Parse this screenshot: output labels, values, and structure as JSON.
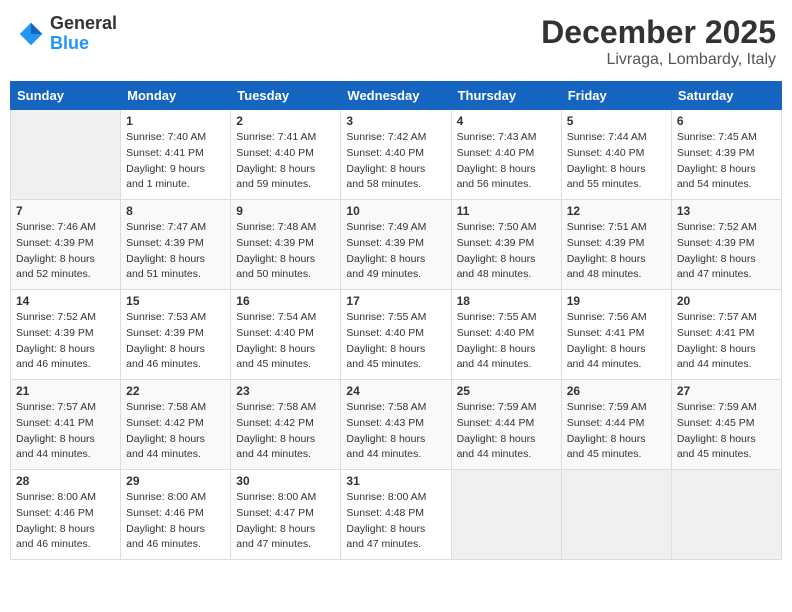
{
  "logo": {
    "general": "General",
    "blue": "Blue"
  },
  "header": {
    "month": "December 2025",
    "location": "Livraga, Lombardy, Italy"
  },
  "days_of_week": [
    "Sunday",
    "Monday",
    "Tuesday",
    "Wednesday",
    "Thursday",
    "Friday",
    "Saturday"
  ],
  "weeks": [
    [
      {
        "day": "",
        "sunrise": "",
        "sunset": "",
        "daylight": ""
      },
      {
        "day": "1",
        "sunrise": "Sunrise: 7:40 AM",
        "sunset": "Sunset: 4:41 PM",
        "daylight": "Daylight: 9 hours and 1 minute."
      },
      {
        "day": "2",
        "sunrise": "Sunrise: 7:41 AM",
        "sunset": "Sunset: 4:40 PM",
        "daylight": "Daylight: 8 hours and 59 minutes."
      },
      {
        "day": "3",
        "sunrise": "Sunrise: 7:42 AM",
        "sunset": "Sunset: 4:40 PM",
        "daylight": "Daylight: 8 hours and 58 minutes."
      },
      {
        "day": "4",
        "sunrise": "Sunrise: 7:43 AM",
        "sunset": "Sunset: 4:40 PM",
        "daylight": "Daylight: 8 hours and 56 minutes."
      },
      {
        "day": "5",
        "sunrise": "Sunrise: 7:44 AM",
        "sunset": "Sunset: 4:40 PM",
        "daylight": "Daylight: 8 hours and 55 minutes."
      },
      {
        "day": "6",
        "sunrise": "Sunrise: 7:45 AM",
        "sunset": "Sunset: 4:39 PM",
        "daylight": "Daylight: 8 hours and 54 minutes."
      }
    ],
    [
      {
        "day": "7",
        "sunrise": "Sunrise: 7:46 AM",
        "sunset": "Sunset: 4:39 PM",
        "daylight": "Daylight: 8 hours and 52 minutes."
      },
      {
        "day": "8",
        "sunrise": "Sunrise: 7:47 AM",
        "sunset": "Sunset: 4:39 PM",
        "daylight": "Daylight: 8 hours and 51 minutes."
      },
      {
        "day": "9",
        "sunrise": "Sunrise: 7:48 AM",
        "sunset": "Sunset: 4:39 PM",
        "daylight": "Daylight: 8 hours and 50 minutes."
      },
      {
        "day": "10",
        "sunrise": "Sunrise: 7:49 AM",
        "sunset": "Sunset: 4:39 PM",
        "daylight": "Daylight: 8 hours and 49 minutes."
      },
      {
        "day": "11",
        "sunrise": "Sunrise: 7:50 AM",
        "sunset": "Sunset: 4:39 PM",
        "daylight": "Daylight: 8 hours and 48 minutes."
      },
      {
        "day": "12",
        "sunrise": "Sunrise: 7:51 AM",
        "sunset": "Sunset: 4:39 PM",
        "daylight": "Daylight: 8 hours and 48 minutes."
      },
      {
        "day": "13",
        "sunrise": "Sunrise: 7:52 AM",
        "sunset": "Sunset: 4:39 PM",
        "daylight": "Daylight: 8 hours and 47 minutes."
      }
    ],
    [
      {
        "day": "14",
        "sunrise": "Sunrise: 7:52 AM",
        "sunset": "Sunset: 4:39 PM",
        "daylight": "Daylight: 8 hours and 46 minutes."
      },
      {
        "day": "15",
        "sunrise": "Sunrise: 7:53 AM",
        "sunset": "Sunset: 4:39 PM",
        "daylight": "Daylight: 8 hours and 46 minutes."
      },
      {
        "day": "16",
        "sunrise": "Sunrise: 7:54 AM",
        "sunset": "Sunset: 4:40 PM",
        "daylight": "Daylight: 8 hours and 45 minutes."
      },
      {
        "day": "17",
        "sunrise": "Sunrise: 7:55 AM",
        "sunset": "Sunset: 4:40 PM",
        "daylight": "Daylight: 8 hours and 45 minutes."
      },
      {
        "day": "18",
        "sunrise": "Sunrise: 7:55 AM",
        "sunset": "Sunset: 4:40 PM",
        "daylight": "Daylight: 8 hours and 44 minutes."
      },
      {
        "day": "19",
        "sunrise": "Sunrise: 7:56 AM",
        "sunset": "Sunset: 4:41 PM",
        "daylight": "Daylight: 8 hours and 44 minutes."
      },
      {
        "day": "20",
        "sunrise": "Sunrise: 7:57 AM",
        "sunset": "Sunset: 4:41 PM",
        "daylight": "Daylight: 8 hours and 44 minutes."
      }
    ],
    [
      {
        "day": "21",
        "sunrise": "Sunrise: 7:57 AM",
        "sunset": "Sunset: 4:41 PM",
        "daylight": "Daylight: 8 hours and 44 minutes."
      },
      {
        "day": "22",
        "sunrise": "Sunrise: 7:58 AM",
        "sunset": "Sunset: 4:42 PM",
        "daylight": "Daylight: 8 hours and 44 minutes."
      },
      {
        "day": "23",
        "sunrise": "Sunrise: 7:58 AM",
        "sunset": "Sunset: 4:42 PM",
        "daylight": "Daylight: 8 hours and 44 minutes."
      },
      {
        "day": "24",
        "sunrise": "Sunrise: 7:58 AM",
        "sunset": "Sunset: 4:43 PM",
        "daylight": "Daylight: 8 hours and 44 minutes."
      },
      {
        "day": "25",
        "sunrise": "Sunrise: 7:59 AM",
        "sunset": "Sunset: 4:44 PM",
        "daylight": "Daylight: 8 hours and 44 minutes."
      },
      {
        "day": "26",
        "sunrise": "Sunrise: 7:59 AM",
        "sunset": "Sunset: 4:44 PM",
        "daylight": "Daylight: 8 hours and 45 minutes."
      },
      {
        "day": "27",
        "sunrise": "Sunrise: 7:59 AM",
        "sunset": "Sunset: 4:45 PM",
        "daylight": "Daylight: 8 hours and 45 minutes."
      }
    ],
    [
      {
        "day": "28",
        "sunrise": "Sunrise: 8:00 AM",
        "sunset": "Sunset: 4:46 PM",
        "daylight": "Daylight: 8 hours and 46 minutes."
      },
      {
        "day": "29",
        "sunrise": "Sunrise: 8:00 AM",
        "sunset": "Sunset: 4:46 PM",
        "daylight": "Daylight: 8 hours and 46 minutes."
      },
      {
        "day": "30",
        "sunrise": "Sunrise: 8:00 AM",
        "sunset": "Sunset: 4:47 PM",
        "daylight": "Daylight: 8 hours and 47 minutes."
      },
      {
        "day": "31",
        "sunrise": "Sunrise: 8:00 AM",
        "sunset": "Sunset: 4:48 PM",
        "daylight": "Daylight: 8 hours and 47 minutes."
      },
      {
        "day": "",
        "sunrise": "",
        "sunset": "",
        "daylight": ""
      },
      {
        "day": "",
        "sunrise": "",
        "sunset": "",
        "daylight": ""
      },
      {
        "day": "",
        "sunrise": "",
        "sunset": "",
        "daylight": ""
      }
    ]
  ]
}
